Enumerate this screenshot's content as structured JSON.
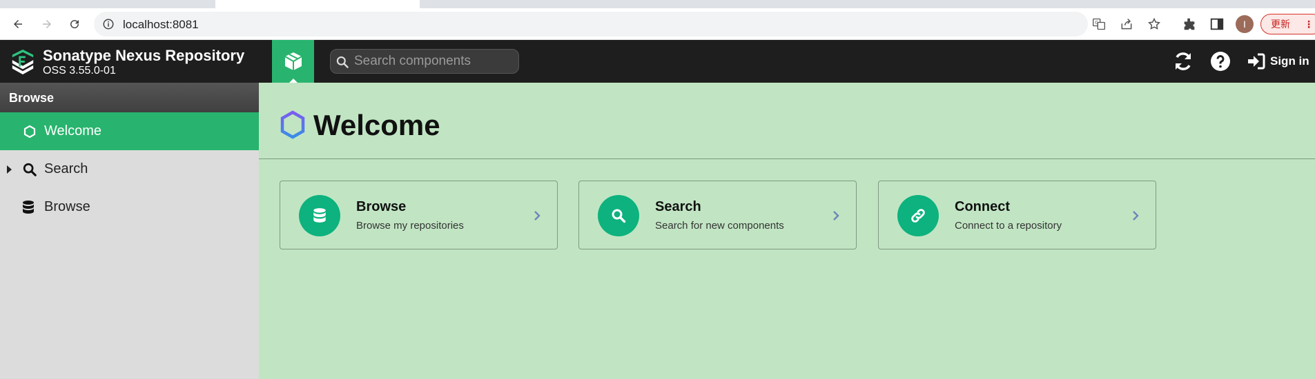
{
  "browser": {
    "url": "localhost:8081",
    "profile_initial": "I",
    "update_label": "更新"
  },
  "app": {
    "name": "Sonatype Nexus Repository",
    "version": "OSS 3.55.0-01",
    "search_placeholder": "Search components",
    "sign_in_label": "Sign in"
  },
  "sidebar": {
    "header": "Browse",
    "items": [
      {
        "label": "Welcome",
        "icon": "hexagon-icon",
        "active": true
      },
      {
        "label": "Search",
        "icon": "search-icon",
        "active": false,
        "expandable": true
      },
      {
        "label": "Browse",
        "icon": "database-icon",
        "active": false
      }
    ]
  },
  "main": {
    "title": "Welcome",
    "cards": [
      {
        "title": "Browse",
        "subtitle": "Browse my repositories",
        "icon": "database-icon"
      },
      {
        "title": "Search",
        "subtitle": "Search for new components",
        "icon": "search-icon"
      },
      {
        "title": "Connect",
        "subtitle": "Connect to a repository",
        "icon": "link-icon"
      }
    ]
  },
  "colors": {
    "accent": "#28b46e",
    "card_icon": "#0db27e",
    "main_bg": "#c1e5c3",
    "header_bg": "#1e1e1e",
    "sidebar_bg": "#dcdcdc",
    "hexagon_gradient": [
      "#7b5cf0",
      "#3a8de6"
    ]
  }
}
